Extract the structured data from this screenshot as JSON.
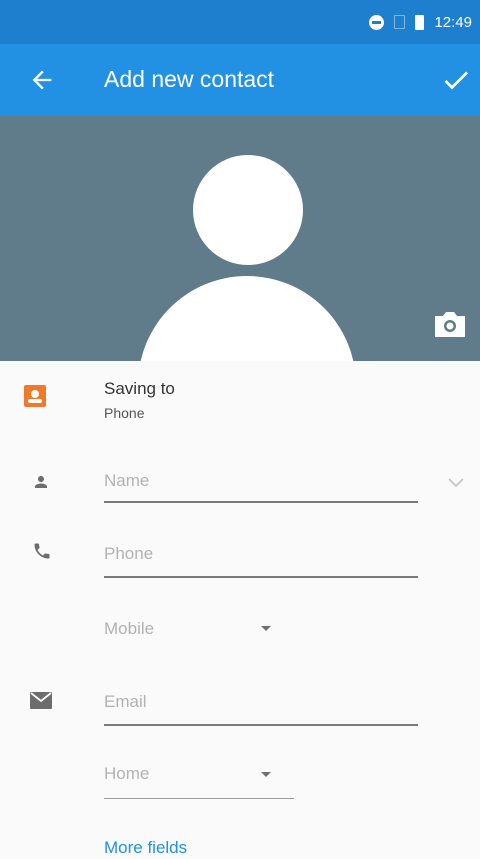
{
  "status_bar": {
    "time": "12:49",
    "icons": [
      "do-not-disturb-icon",
      "no-sim-icon",
      "battery-icon"
    ]
  },
  "app_bar": {
    "title": "Add new contact",
    "back_icon": "arrow-back-icon",
    "save_icon": "check-icon"
  },
  "photo": {
    "camera_icon": "camera-icon",
    "placeholder": "person-silhouette"
  },
  "account": {
    "label": "Saving to",
    "value": "Phone",
    "icon": "phone-account-icon"
  },
  "fields": {
    "name": {
      "placeholder": "Name",
      "icon": "person-icon",
      "expand_icon": "chevron-down-icon"
    },
    "phone": {
      "placeholder": "Phone",
      "icon": "phone-icon",
      "type": "Mobile"
    },
    "email": {
      "placeholder": "Email",
      "icon": "email-icon",
      "type": "Home"
    }
  },
  "more_fields": "More fields",
  "colors": {
    "status_bar": "#1e7fcf",
    "app_bar": "#2391e3",
    "photo_bg": "#607c8a",
    "accent": "#2391e3",
    "account_icon": "#f07a2c"
  }
}
